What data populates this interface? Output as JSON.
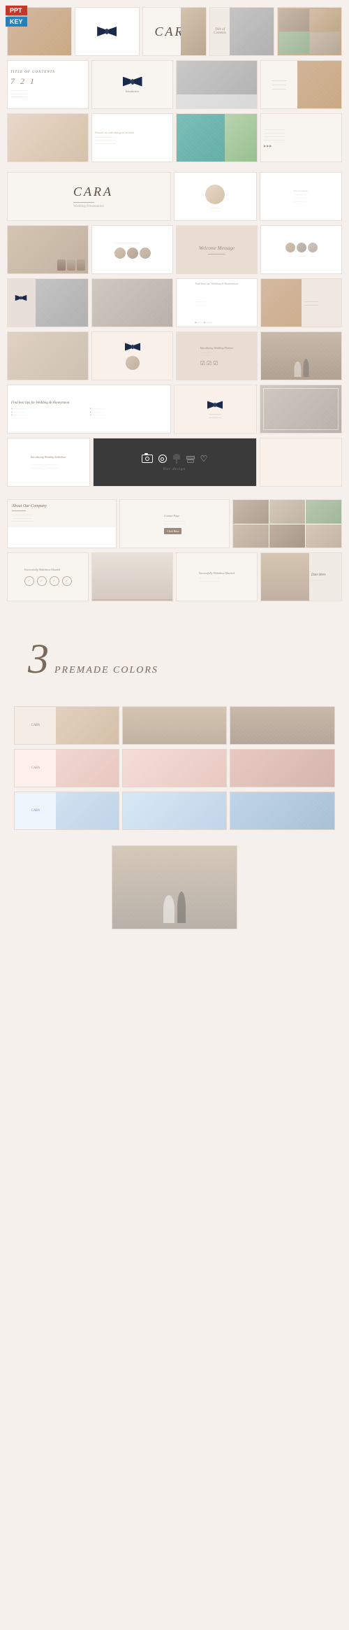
{
  "badges": {
    "ppt": "PPT",
    "key": "KEY"
  },
  "title": "CARA",
  "subtitle": "Wedding Presentation Template",
  "slides": {
    "row1": [
      "cover-photo",
      "bow-tie-slide",
      "cara-title",
      "couple-photo",
      "gift-photo"
    ],
    "row2": [
      "toc-slide",
      "photos-collage",
      "bride-photo",
      "couple-dance"
    ]
  },
  "bottom": {
    "number": "3",
    "text": "Premade Colors"
  },
  "colors": {
    "accent": "#7a6a5a",
    "light": "#f5f0eb",
    "dark": "#3a3a3a",
    "pink_variant": "#f5ddd8",
    "blue_variant": "#d8e8f5"
  }
}
